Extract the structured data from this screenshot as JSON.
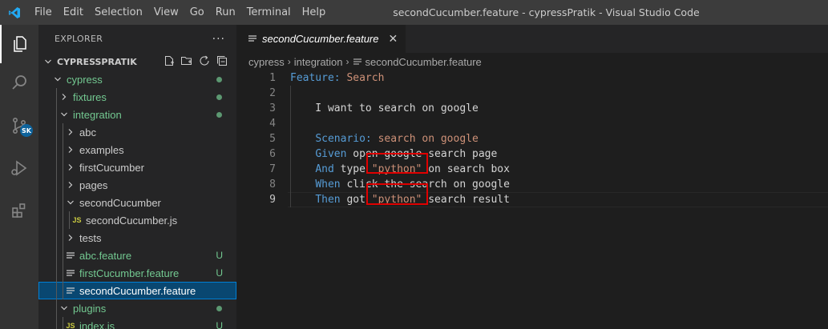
{
  "titlebar": {
    "menu": [
      "File",
      "Edit",
      "Selection",
      "View",
      "Go",
      "Run",
      "Terminal",
      "Help"
    ],
    "window_title": "secondCucumber.feature - cypressPratik - Visual Studio Code"
  },
  "activitybar": {
    "items": [
      "explorer-icon",
      "search-icon",
      "source-control-icon",
      "run-debug-icon",
      "extensions-icon"
    ],
    "account_badge": "SK"
  },
  "sidebar": {
    "header": "EXPLORER",
    "more": "···",
    "project": "CYPRESSPRATIK",
    "tree": [
      {
        "label": "cypress",
        "status": "dot"
      },
      {
        "label": "fixtures",
        "status": "dot"
      },
      {
        "label": "integration",
        "status": "dot"
      },
      {
        "label": "abc"
      },
      {
        "label": "examples"
      },
      {
        "label": "firstCucumber"
      },
      {
        "label": "pages"
      },
      {
        "label": "secondCucumber"
      },
      {
        "label": "secondCucumber.js",
        "icon": "JS"
      },
      {
        "label": "tests"
      },
      {
        "label": "abc.feature",
        "status": "U"
      },
      {
        "label": "firstCucumber.feature",
        "status": "U"
      },
      {
        "label": "secondCucumber.feature"
      },
      {
        "label": "plugins",
        "status": "dot"
      },
      {
        "label": "index.js",
        "icon": "JS",
        "status": "U"
      }
    ]
  },
  "editor": {
    "tab_label": "secondCucumber.feature",
    "tab_close": "✕",
    "breadcrumbs": [
      "cypress",
      "integration",
      "secondCucumber.feature"
    ],
    "lines": {
      "1": {
        "kw": "Feature:",
        "rest": " Search"
      },
      "2": "",
      "3": "    I want to search on google",
      "4": "",
      "5": {
        "kw": "Scenario:",
        "rest": " search on google"
      },
      "6": {
        "kw": "Given",
        "rest": " open google search page"
      },
      "7": {
        "kw": "And",
        "pre": " type ",
        "str": "\"python\"",
        "post": " on search box"
      },
      "8": {
        "kw": "When",
        "rest": " click the search on google"
      },
      "9": {
        "kw": "Then",
        "pre": " got ",
        "str": "\"python\"",
        "post": " search result"
      }
    },
    "line_numbers": [
      "1",
      "2",
      "3",
      "4",
      "5",
      "6",
      "7",
      "8",
      "9"
    ],
    "active_line": "9"
  },
  "colors": {
    "keyword": "#569cd6",
    "string": "#ce9178",
    "git_untracked": "#73c991",
    "annotation_box": "#e00000"
  }
}
